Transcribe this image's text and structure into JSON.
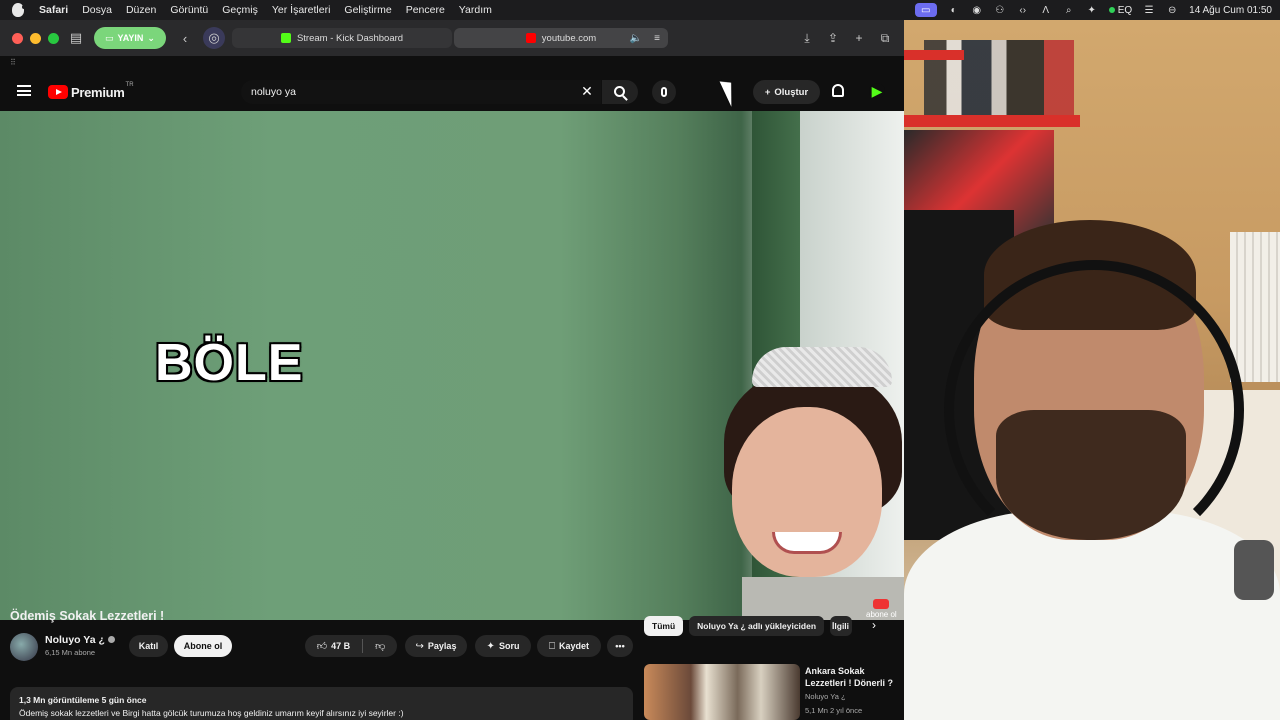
{
  "menubar": {
    "app": "Safari",
    "items": [
      "Dosya",
      "Düzen",
      "Görüntü",
      "Geçmiş",
      "Yer İşaretleri",
      "Geliştirme",
      "Pencere",
      "Yardım"
    ],
    "status": {
      "eq_label": "EQ",
      "datetime": "14 Ağu Cum  01:50"
    }
  },
  "safari": {
    "tab_group_label": "YAYIN",
    "tabs": [
      {
        "title": "Stream - Kick Dashboard",
        "favicon_color": "#53fc18"
      },
      {
        "title": "youtube.com",
        "favicon_color": "#ff0000"
      }
    ]
  },
  "youtube": {
    "logo_text": "Premium",
    "country_code": "TR",
    "search_value": "noluyo ya",
    "create_label": "Oluştur",
    "video": {
      "overlay_caption": "BÖLE",
      "watermark_text": "abone ol",
      "title": "Ödemiş Sokak Lezzetleri !"
    },
    "channel": {
      "name": "Noluyo Ya ¿",
      "subscribers": "6,15 Mn abone",
      "join_label": "Katıl",
      "subscribe_label": "Abone ol"
    },
    "actions": {
      "likes": "47 B",
      "share_label": "Paylaş",
      "ask_label": "Soru",
      "save_label": "Kaydet"
    },
    "description": {
      "meta": "1,3 Mn görüntüleme  5 gün önce",
      "text": "Ödemiş sokak lezzetleri ve Birgi hatta gölcük turumuza hoş geldiniz umarım keyif alırsınız iyi seyirler :)"
    },
    "chips": [
      "Tümü",
      "Noluyo Ya ¿ adlı yükleyiciden",
      "İlgili"
    ],
    "recommendation": {
      "title": "Ankara Sokak Lezzetleri ! Dönerli ?",
      "channel": "Noluyo Ya ¿",
      "meta": "5,1 Mn   2 yıl önce"
    }
  }
}
